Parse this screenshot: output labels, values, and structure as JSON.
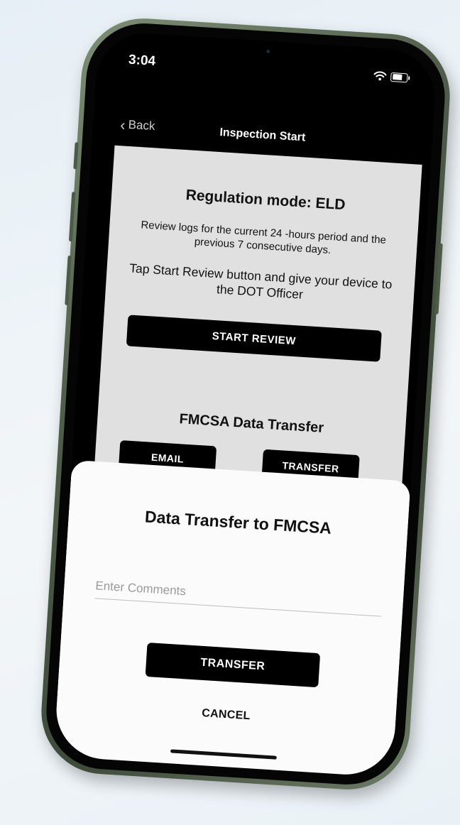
{
  "status_bar": {
    "time": "3:04",
    "icons": [
      "wifi-icon",
      "battery-icon"
    ]
  },
  "nav": {
    "back_label": "Back",
    "back_icon": "chevron-left-icon",
    "title": "Inspection Start"
  },
  "inspection": {
    "regulation_mode": "Regulation mode: ELD",
    "description": "Review logs for the current 24 -hours period and the previous 7 consecutive days.",
    "instruction": "Tap Start Review button and give your device to the DOT Officer",
    "start_review_label": "START REVIEW",
    "fmcsa_title": "FMCSA Data Transfer",
    "email_label": "EMAIL",
    "transfer_label": "TRANSFER"
  },
  "dialog": {
    "title": "Data Transfer to FMCSA",
    "comments_placeholder": "Enter Comments",
    "comments_value": "",
    "transfer_label": "TRANSFER",
    "cancel_label": "CANCEL"
  },
  "colors": {
    "frame": "#4f5d4a",
    "card": "#e0e0e0",
    "sheet": "#fbfbfb",
    "button": "#000000"
  }
}
